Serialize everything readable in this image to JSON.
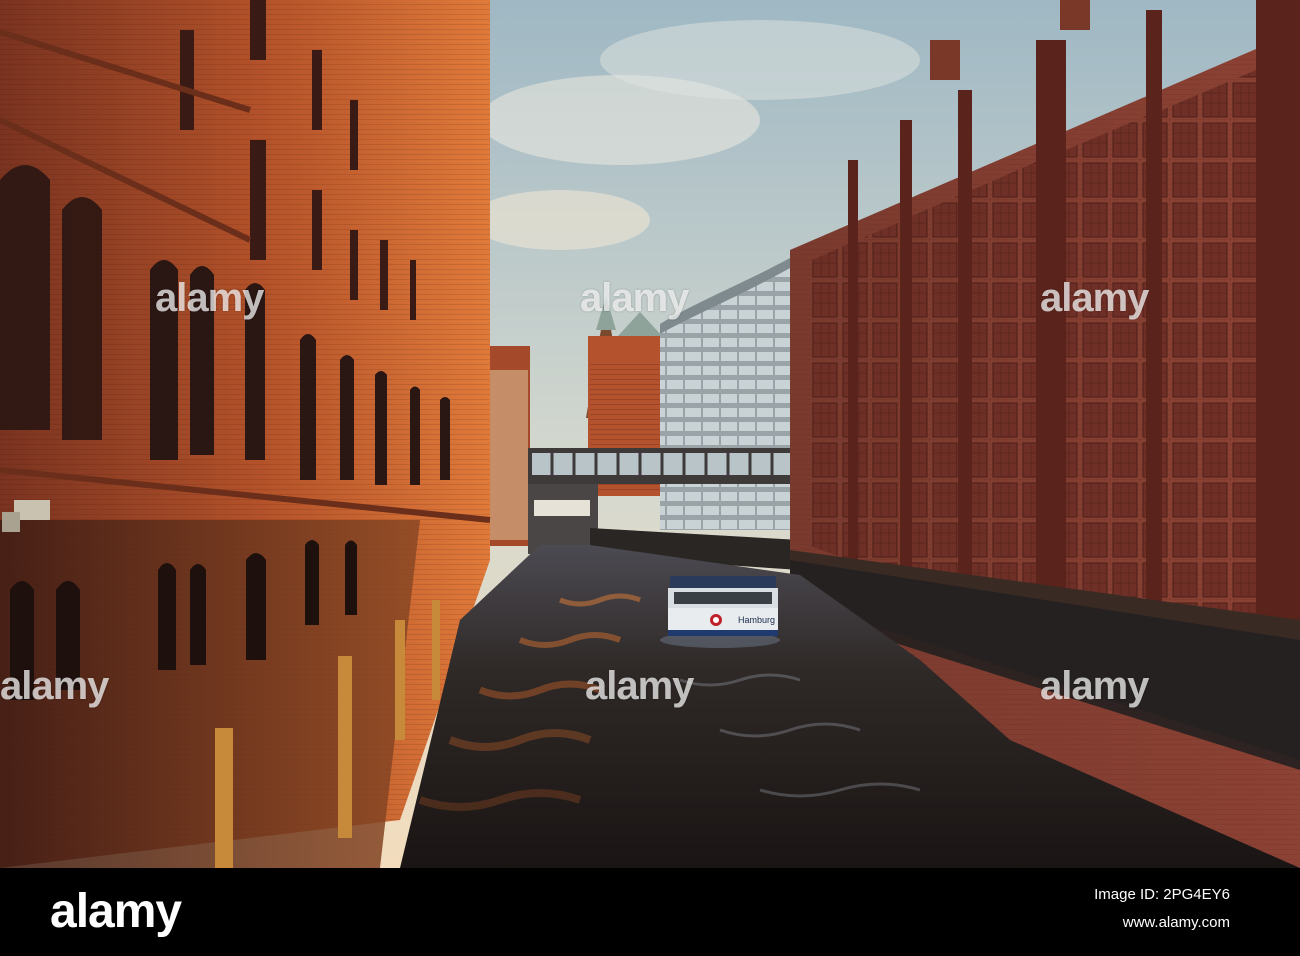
{
  "watermarks": {
    "text": "alamy"
  },
  "boat": {
    "label": "Hamburg"
  },
  "footer": {
    "brand": "alamy",
    "image_id": "Image ID: 2PG4EY6",
    "website": "www.alamy.com"
  },
  "colors": {
    "sky_top": "#a9c3cf",
    "sky_bottom": "#f2ddc0",
    "brick_lit": "#c8602a",
    "brick_shade": "#5c2a1c",
    "warehouse_right": "#8a3c30",
    "water": "#2a2220"
  }
}
